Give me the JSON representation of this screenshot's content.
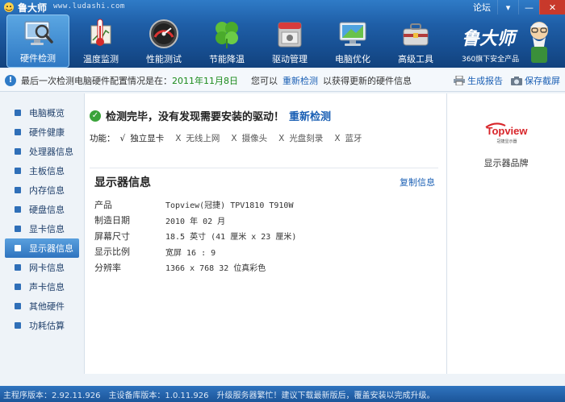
{
  "app": {
    "name": "鲁大师",
    "url": "www.ludashi.com",
    "forum": "论坛",
    "min_symbol": "▾",
    "minimize_symbol": "—",
    "close_symbol": "✕"
  },
  "nav": {
    "items": [
      {
        "label": "硬件检测",
        "icon": "monitor-magnifier-icon"
      },
      {
        "label": "温度监测",
        "icon": "thermometer-icon"
      },
      {
        "label": "性能测试",
        "icon": "speedometer-icon"
      },
      {
        "label": "节能降温",
        "icon": "clover-icon"
      },
      {
        "label": "驱动管理",
        "icon": "driver-box-icon"
      },
      {
        "label": "电脑优化",
        "icon": "computer-optimize-icon"
      },
      {
        "label": "高级工具",
        "icon": "toolbox-icon"
      }
    ],
    "active_index": 0
  },
  "brand": {
    "name": "鲁大师",
    "tagline": "360旗下安全产品"
  },
  "infobar": {
    "prefix": "最后一次检测电脑硬件配置情况是在：",
    "date": "2011年11月8日",
    "you_can": "您可以",
    "redetect": "重新检测",
    "suffix": "以获得更新的硬件信息",
    "report": "生成报告",
    "screenshot": "保存截屏"
  },
  "sidebar": {
    "items": [
      "电脑概览",
      "硬件健康",
      "处理器信息",
      "主板信息",
      "内存信息",
      "硬盘信息",
      "显卡信息",
      "显示器信息",
      "网卡信息",
      "声卡信息",
      "其他硬件",
      "功耗估算"
    ],
    "active_index": 7
  },
  "main": {
    "status": "检测完毕，没有发现需要安装的驱动！",
    "status_link": "重新检测",
    "features_label": "功能：",
    "features": [
      {
        "mark": "√",
        "label": "独立显卡"
      },
      {
        "mark": "X",
        "label": "无线上网"
      },
      {
        "mark": "X",
        "label": "摄像头"
      },
      {
        "mark": "X",
        "label": "光盘刻录"
      },
      {
        "mark": "X",
        "label": "蓝牙"
      }
    ],
    "section_title": "显示器信息",
    "copy": "复制信息",
    "specs": [
      {
        "key": "产品",
        "value": "Topview(冠捷) TPV1810 T910W"
      },
      {
        "key": "制造日期",
        "value": "2010 年 02 月"
      },
      {
        "key": "屏幕尺寸",
        "value": "18.5 英寸 (41 厘米 x 23 厘米)"
      },
      {
        "key": "显示比例",
        "value": "宽屏 16 : 9"
      },
      {
        "key": "分辨率",
        "value": "1366 x 768 32 位真彩色"
      }
    ]
  },
  "right": {
    "logo_text": "Topview",
    "logo_sub": "冠捷显示器",
    "label": "显示器品牌"
  },
  "statusbar": {
    "program_version": "主程序版本：2.92.11.926",
    "db_version": "主设备库版本：1.0.11.926",
    "notice": "升级服务器繁忙！建议下载最新版后，覆盖安装以完成升级。"
  },
  "colors": {
    "accent": "#1a5fb4",
    "ok": "#3aa33a",
    "date": "#1a8a1a",
    "close": "#c8392b"
  }
}
